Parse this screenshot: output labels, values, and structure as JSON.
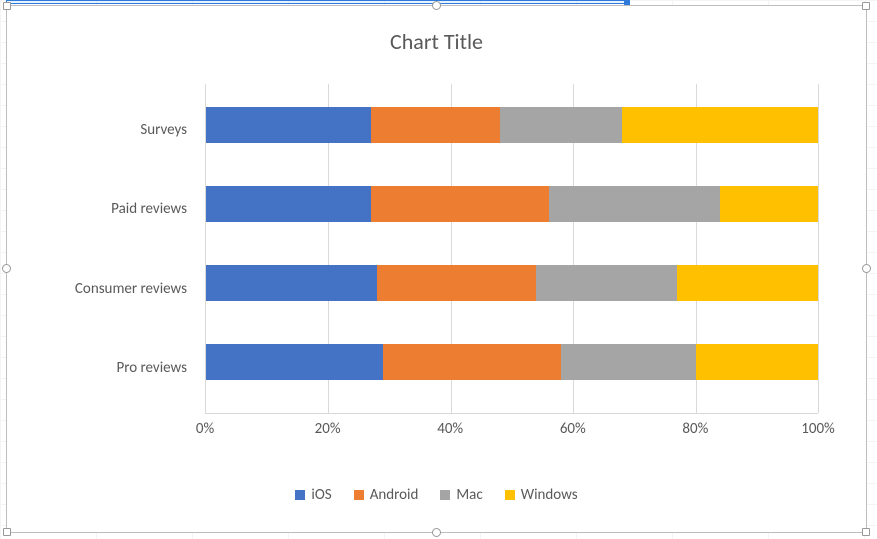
{
  "chart_data": {
    "type": "bar",
    "orientation": "horizontal_stacked_100",
    "title": "Chart Title",
    "categories": [
      "Pro reviews",
      "Consumer reviews",
      "Paid reviews",
      "Surveys"
    ],
    "series": [
      {
        "name": "iOS",
        "color": "#4472C4",
        "values": [
          29,
          28,
          27,
          27
        ]
      },
      {
        "name": "Android",
        "color": "#ED7D31",
        "values": [
          29,
          26,
          29,
          21
        ]
      },
      {
        "name": "Mac",
        "color": "#A5A5A5",
        "values": [
          22,
          23,
          28,
          20
        ]
      },
      {
        "name": "Windows",
        "color": "#FFC000",
        "values": [
          20,
          23,
          16,
          32
        ]
      }
    ],
    "xticks": [
      0,
      20,
      40,
      60,
      80,
      100
    ],
    "xtick_labels": [
      "0%",
      "20%",
      "40%",
      "60%",
      "80%",
      "100%"
    ],
    "xlabel": "",
    "ylabel": ""
  }
}
